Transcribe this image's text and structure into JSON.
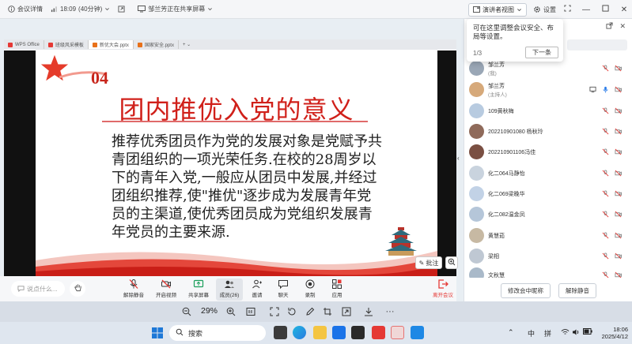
{
  "topbar": {
    "meeting_details": "会议详情",
    "time": "18:09",
    "duration": "(40分钟)",
    "sharing": "邹兰芳正在共享屏幕",
    "speaker_view": "演讲者视图",
    "settings": "设置"
  },
  "notice": {
    "text": "当前网络状态不佳，可能影响通话质量，建议使用电话音频保障音质。",
    "link": "使用电话音频"
  },
  "browser_tabs": [
    {
      "label": "WPS Office",
      "color": "#e53935"
    },
    {
      "label": "班级风采模板",
      "color": "#e53935"
    },
    {
      "label": "新优大会.pptx",
      "color": "#e8711a"
    },
    {
      "label": "国家安全.pptx",
      "color": "#e8711a"
    }
  ],
  "slide": {
    "number": "04",
    "title": "团内推优入党的意义",
    "body": "推荐优秀团员作为党的发展对象是党赋予共青团组织的一项光荣任务.在校的28周岁以下的青年入党,一般应从团员中发展,并经过团组织推荐,使\"推优\"逐步成为发展青年党员的主渠道,使优秀团员成为党组织发展青年党员的主要来源.",
    "annotate": "批注"
  },
  "toolbar": {
    "chat_placeholder": "说点什么...",
    "buttons": [
      {
        "label": "解除静音",
        "icon": "mic-muted-icon"
      },
      {
        "label": "开启视频",
        "icon": "camera-off-icon"
      },
      {
        "label": "共享屏幕",
        "icon": "screen-share-icon"
      },
      {
        "label": "成员(26)",
        "icon": "members-icon"
      },
      {
        "label": "邀请",
        "icon": "invite-icon"
      },
      {
        "label": "聊天",
        "icon": "chat-icon"
      },
      {
        "label": "录制",
        "icon": "record-icon"
      },
      {
        "label": "应用",
        "icon": "apps-icon"
      },
      {
        "label": "离开会议",
        "icon": "leave-icon"
      }
    ]
  },
  "tooltip": {
    "text": "可在这里调整会议安全、布局等设置。",
    "step": "1/3",
    "next": "下一条"
  },
  "participants": [
    {
      "name": "邹兰芳",
      "sub": "(我)",
      "color": "#9aa7b6"
    },
    {
      "name": "邹兰芳",
      "sub": "(主持人)",
      "color": "#d6a97a"
    },
    {
      "name": "109黄秋梅",
      "sub": "",
      "color": "#b8cbe0"
    },
    {
      "name": "202210901080 杨秋玲",
      "sub": "",
      "color": "#8f6a5a"
    },
    {
      "name": "202210901106冯佳",
      "sub": "",
      "color": "#7a4f42"
    },
    {
      "name": "化二064马静怡",
      "sub": "",
      "color": "#c9d3de"
    },
    {
      "name": "化二069梁晚华",
      "sub": "",
      "color": "#c2d2e6"
    },
    {
      "name": "化二082温金凤",
      "sub": "",
      "color": "#b5c6d9"
    },
    {
      "name": "黄慧茹",
      "sub": "",
      "color": "#c7b9a3"
    },
    {
      "name": "梁相",
      "sub": "",
      "color": "#bfc8d3"
    },
    {
      "name": "文秋慧",
      "sub": "",
      "color": "#a9b9c9"
    }
  ],
  "panel_footer": {
    "rename": "修改会中昵称",
    "unmute": "解除静音"
  },
  "zoom": {
    "percent": "29%"
  },
  "taskbar": {
    "search": "搜索",
    "ime1": "中",
    "ime2": "拼",
    "time": "18:06",
    "date": "2025/4/12"
  },
  "colors": {
    "accent": "#1e6fe0",
    "slide_red": "#d0201a",
    "danger": "#e53935"
  }
}
